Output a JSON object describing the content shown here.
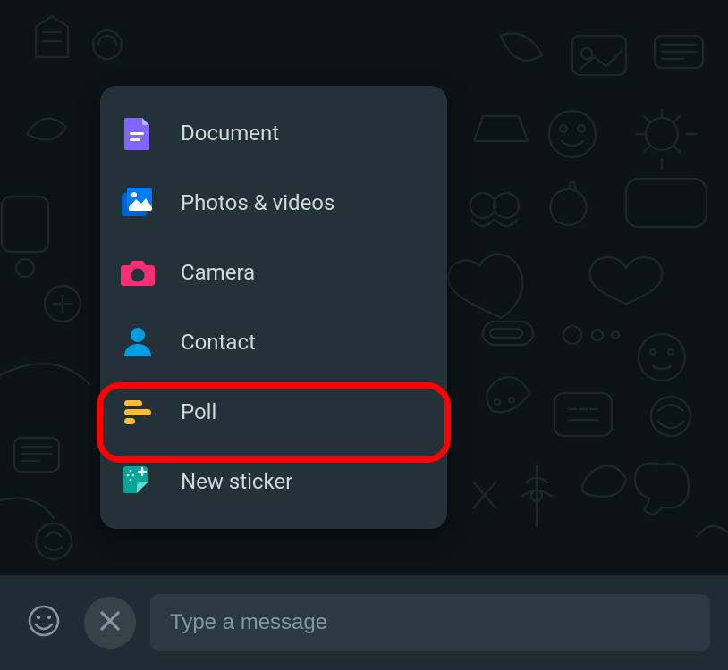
{
  "attachMenu": {
    "items": [
      {
        "label": "Document",
        "iconName": "document-icon",
        "iconColor": "#7f66ff"
      },
      {
        "label": "Photos & videos",
        "iconName": "photos-icon",
        "iconColor": "#007bfc"
      },
      {
        "label": "Camera",
        "iconName": "camera-icon",
        "iconColor": "#ff2e74"
      },
      {
        "label": "Contact",
        "iconName": "contact-icon",
        "iconColor": "#009de2"
      },
      {
        "label": "Poll",
        "iconName": "poll-icon",
        "iconColor": "#ffbc38"
      },
      {
        "label": "New sticker",
        "iconName": "sticker-icon",
        "iconColor": "#02a698"
      }
    ],
    "highlightedIndex": 4
  },
  "inputBar": {
    "placeholder": "Type a message"
  },
  "colors": {
    "panel": "#233138",
    "inputBar": "#202c33",
    "inputField": "#2a3942",
    "text": "#d1d7db",
    "muted": "#8696a0",
    "highlightRing": "#ff0000"
  }
}
